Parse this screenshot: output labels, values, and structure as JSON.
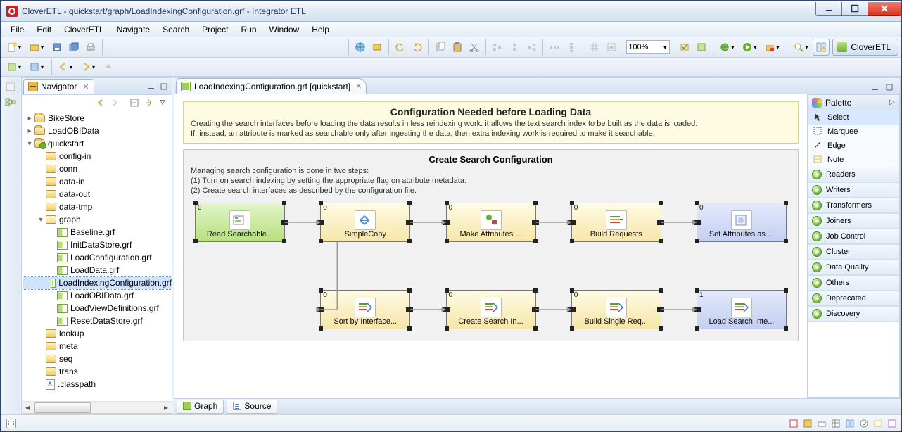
{
  "window": {
    "title": "CloverETL - quickstart/graph/LoadIndexingConfiguration.grf - Integrator ETL"
  },
  "menu": [
    "File",
    "Edit",
    "CloverETL",
    "Navigate",
    "Search",
    "Project",
    "Run",
    "Window",
    "Help"
  ],
  "zoom": "100%",
  "perspective": "CloverETL",
  "navigator": {
    "title": "Navigator",
    "projects": [
      {
        "name": "BikeStore",
        "type": "proj"
      },
      {
        "name": "LoadOBIData",
        "type": "proj"
      },
      {
        "name": "quickstart",
        "type": "proj-open",
        "children": [
          {
            "name": "config-in",
            "type": "folder"
          },
          {
            "name": "conn",
            "type": "folder"
          },
          {
            "name": "data-in",
            "type": "folder"
          },
          {
            "name": "data-out",
            "type": "folder"
          },
          {
            "name": "data-tmp",
            "type": "folder"
          },
          {
            "name": "graph",
            "type": "folder-open",
            "children": [
              {
                "name": "Baseline.grf",
                "type": "grf"
              },
              {
                "name": "InitDataStore.grf",
                "type": "grf"
              },
              {
                "name": "LoadConfiguration.grf",
                "type": "grf"
              },
              {
                "name": "LoadData.grf",
                "type": "grf"
              },
              {
                "name": "LoadIndexingConfiguration.grf",
                "type": "grf",
                "selected": true
              },
              {
                "name": "LoadOBIData.grf",
                "type": "grf"
              },
              {
                "name": "LoadViewDefinitions.grf",
                "type": "grf"
              },
              {
                "name": "ResetDataStore.grf",
                "type": "grf"
              }
            ]
          },
          {
            "name": "lookup",
            "type": "folder"
          },
          {
            "name": "meta",
            "type": "folder"
          },
          {
            "name": "seq",
            "type": "folder"
          },
          {
            "name": "trans",
            "type": "folder"
          },
          {
            "name": ".classpath",
            "type": "file"
          }
        ]
      }
    ]
  },
  "editor": {
    "tab_label": "LoadIndexingConfiguration.grf [quickstart]",
    "note": {
      "title": "Configuration Needed before Loading Data",
      "line1": "Creating the search interfaces before loading the data results in less reindexing work: it allows the text search index to be built as the data is loaded.",
      "line2": "If, instead, an attribute is marked as searchable only after ingesting the data, then extra indexing work is required to make it searchable."
    },
    "group": {
      "title": "Create Search Configuration",
      "line1": "Managing search configuration is done in two steps:",
      "line2": "(1) Turn on search indexing by setting the appropriate flag on attribute metadata.",
      "line3": "(2) Create search interfaces as described by the configuration file."
    },
    "row1": [
      {
        "num": "0",
        "label": "Read Searchable...",
        "style": "green"
      },
      {
        "num": "0",
        "label": "SimpleCopy",
        "style": "yellow"
      },
      {
        "num": "0",
        "label": "Make Attributes ...",
        "style": "yellow"
      },
      {
        "num": "0",
        "label": "Build Requests",
        "style": "yellow"
      },
      {
        "num": "0",
        "label": "Set Attributes as ...",
        "style": "blue"
      }
    ],
    "row2": [
      {
        "num": "0",
        "label": "Sort by Interface...",
        "style": "yellow"
      },
      {
        "num": "0",
        "label": "Create Search In...",
        "style": "yellow"
      },
      {
        "num": "0",
        "label": "Build Single Req...",
        "style": "yellow"
      },
      {
        "num": "1",
        "label": "Load Search Inte...",
        "style": "blue"
      }
    ],
    "bottom_tabs": [
      "Graph",
      "Source"
    ]
  },
  "palette": {
    "title": "Palette",
    "tools": [
      "Select",
      "Marquee",
      "Edge",
      "Note"
    ],
    "categories": [
      "Readers",
      "Writers",
      "Transformers",
      "Joiners",
      "Job Control",
      "Cluster",
      "Data Quality",
      "Others",
      "Deprecated",
      "Discovery"
    ]
  }
}
